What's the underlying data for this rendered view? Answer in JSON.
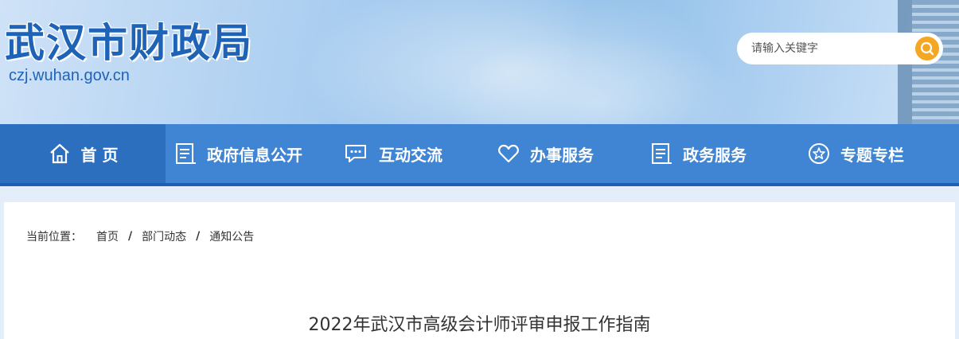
{
  "header": {
    "site_title": "武汉市财政局",
    "site_domain": "czj.wuhan.gov.cn"
  },
  "search": {
    "placeholder": "请输入关键字",
    "icon": "search-icon"
  },
  "nav": {
    "items": [
      {
        "label": "首 页",
        "icon": "home-icon",
        "active": true
      },
      {
        "label": "政府信息公开",
        "icon": "document-icon",
        "active": false
      },
      {
        "label": "互动交流",
        "icon": "chat-icon",
        "active": false
      },
      {
        "label": "办事服务",
        "icon": "heart-icon",
        "active": false
      },
      {
        "label": "政务服务",
        "icon": "document-icon",
        "active": false
      },
      {
        "label": "专题专栏",
        "icon": "star-icon",
        "active": false
      }
    ]
  },
  "breadcrumb": {
    "label": "当前位置：",
    "items": [
      "首页",
      "部门动态",
      "通知公告"
    ],
    "separator": "/"
  },
  "article": {
    "title": "2022年武汉市高级会计师评审申报工作指南"
  },
  "colors": {
    "brand_blue": "#1f63b6",
    "nav_bg": "#3f85d4",
    "nav_active": "#2d6fbf",
    "search_button": "#f5a623"
  }
}
